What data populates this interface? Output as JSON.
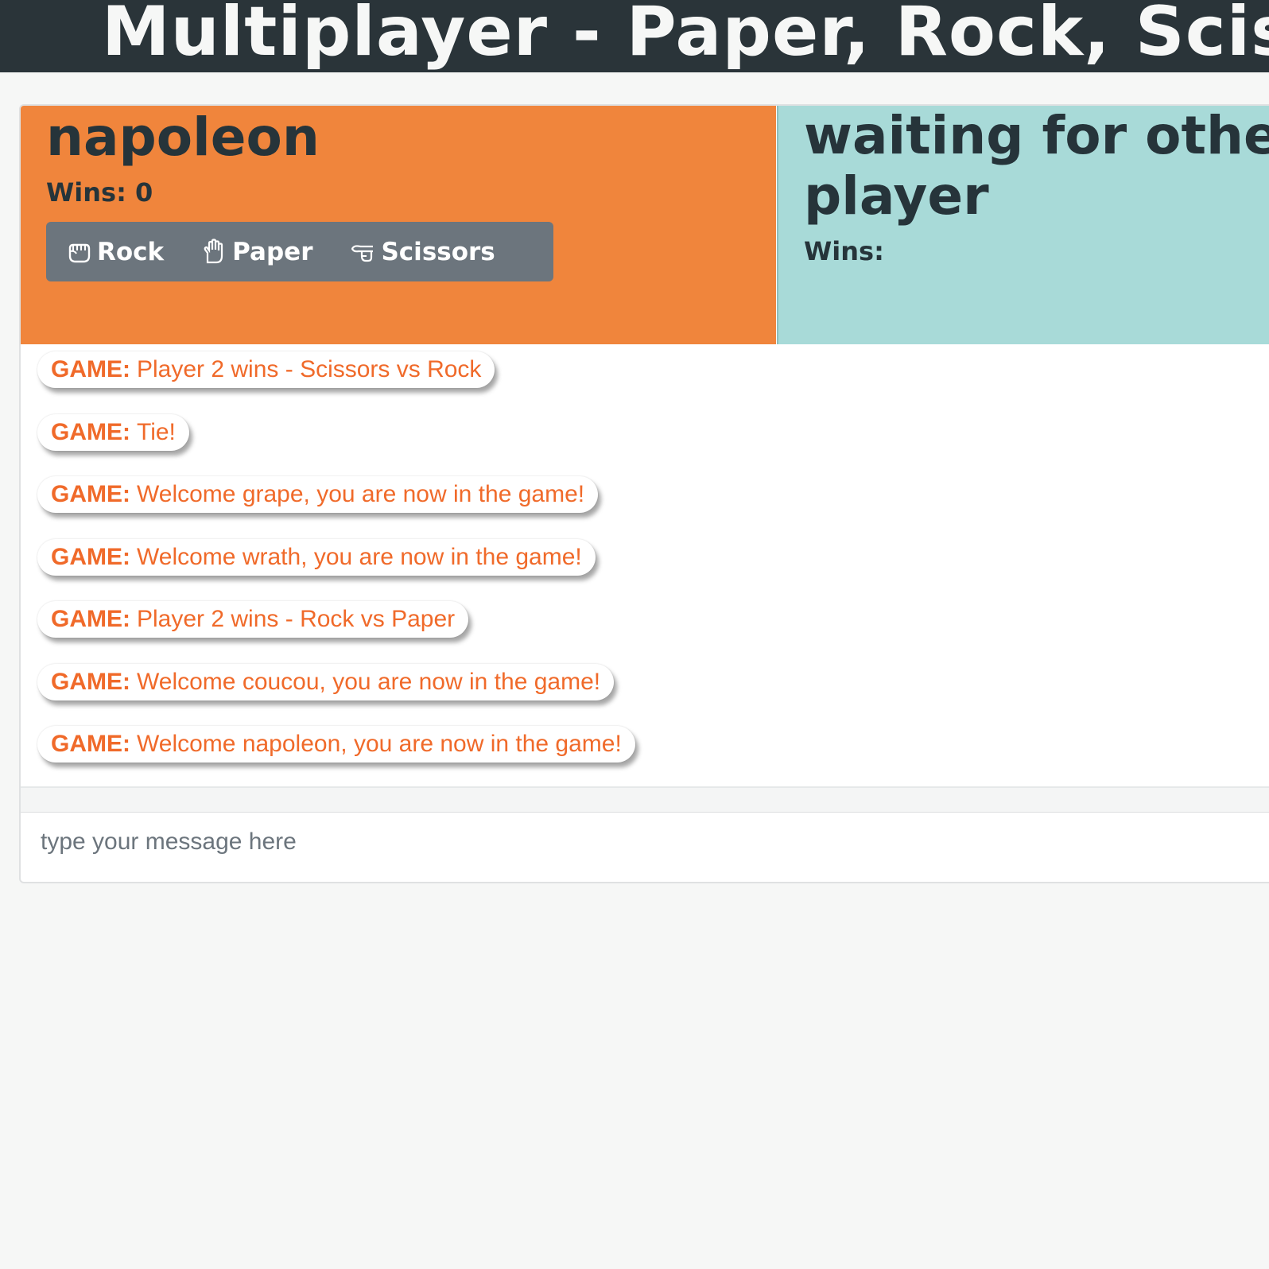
{
  "header": {
    "title": "Multiplayer - Paper, Rock, Scissors"
  },
  "player1": {
    "name": "napoleon",
    "wins_label": "Wins: 0",
    "choices": [
      {
        "label": "Rock",
        "icon": "hand-rock-icon"
      },
      {
        "label": "Paper",
        "icon": "hand-paper-icon"
      },
      {
        "label": "Scissors",
        "icon": "hand-scissors-icon"
      }
    ]
  },
  "player2": {
    "name": "waiting for other player",
    "wins_label": "Wins:"
  },
  "chat": {
    "messages": [
      {
        "tag": "GAME:",
        "text": "Player 2 wins - Scissors vs Rock"
      },
      {
        "tag": "GAME:",
        "text": "Tie!"
      },
      {
        "tag": "GAME:",
        "text": "Welcome grape, you are now in the game!"
      },
      {
        "tag": "GAME:",
        "text": "Welcome wrath, you are now in the game!"
      },
      {
        "tag": "GAME:",
        "text": "Player 2 wins - Rock vs Paper"
      },
      {
        "tag": "GAME:",
        "text": "Welcome coucou, you are now in the game!"
      },
      {
        "tag": "GAME:",
        "text": "Welcome napoleon, you are now in the game!"
      }
    ],
    "input_placeholder": "type your message here"
  },
  "colors": {
    "header_bg": "#2a3439",
    "player1_bg": "#f0853c",
    "player2_bg": "#a8dad8",
    "choices_bg": "#6c757d",
    "message_text": "#f06a2a"
  }
}
